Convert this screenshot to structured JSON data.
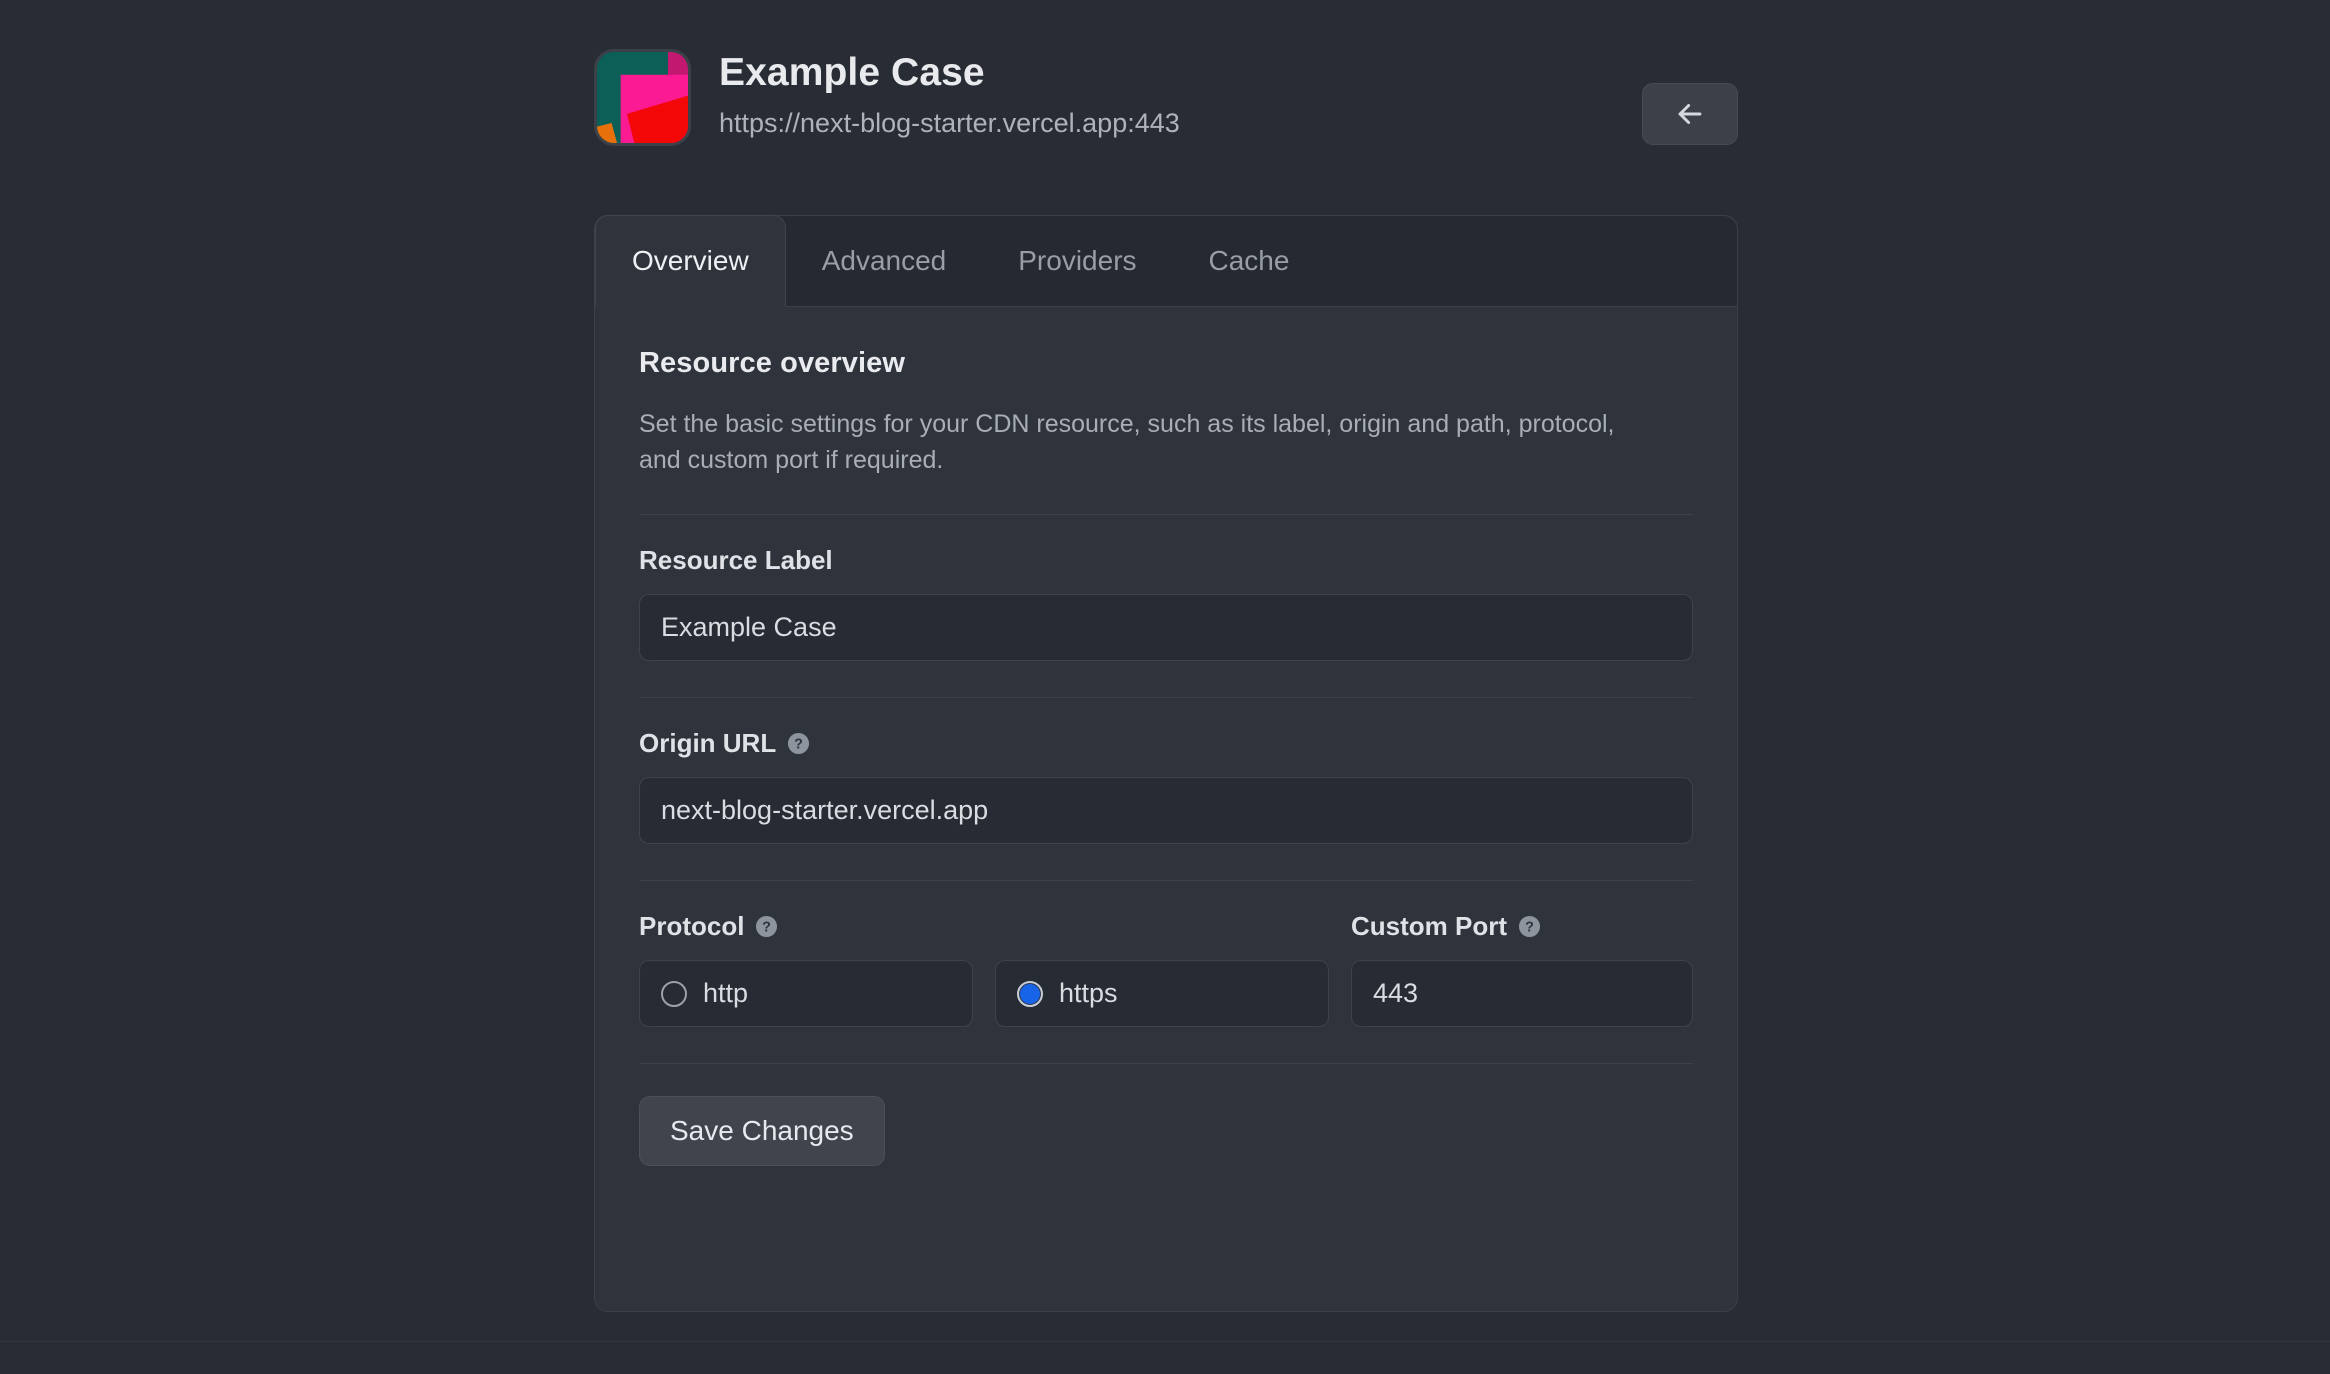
{
  "header": {
    "title": "Example Case",
    "subtitle": "https://next-blog-starter.vercel.app:443",
    "logo_icon": "app-logo-icon",
    "back_icon": "arrow-left-icon",
    "back_label": ""
  },
  "tabs": [
    {
      "label": "Overview",
      "active": true
    },
    {
      "label": "Advanced",
      "active": false
    },
    {
      "label": "Providers",
      "active": false
    },
    {
      "label": "Cache",
      "active": false
    }
  ],
  "overview": {
    "section_title": "Resource overview",
    "section_desc": "Set the basic settings for your CDN resource, such as its label, origin and path, protocol, and custom port if required.",
    "resource_label": {
      "label": "Resource Label",
      "value": "Example Case",
      "placeholder": "Resource Label"
    },
    "origin_url": {
      "label": "Origin URL",
      "value": "next-blog-starter.vercel.app",
      "placeholder": "Origin URL",
      "help_icon": "question-mark-icon"
    },
    "protocol": {
      "label": "Protocol",
      "help_icon": "question-mark-icon",
      "selected": "https",
      "options": [
        {
          "value": "http",
          "label": "http",
          "checked": false
        },
        {
          "value": "https",
          "label": "https",
          "checked": true
        }
      ]
    },
    "custom_port": {
      "label": "Custom Port",
      "help_icon": "question-mark-icon",
      "value": "443",
      "placeholder": "Custom Port"
    },
    "save_label": "Save Changes"
  },
  "colors": {
    "page_background": "#282c34",
    "card_background": "#2f333c",
    "tabstrip_background": "#252931",
    "input_background": "#272b33",
    "border": "#3a3f48",
    "text_primary": "#e8eaed",
    "text_muted": "#a8adb6",
    "accent_radio": "#1864e8",
    "logo_teal": "#0b5f56",
    "logo_magenta": "#c2186f",
    "logo_pink": "#fa1a91",
    "logo_red": "#f40707",
    "logo_orange": "#e8700a"
  }
}
